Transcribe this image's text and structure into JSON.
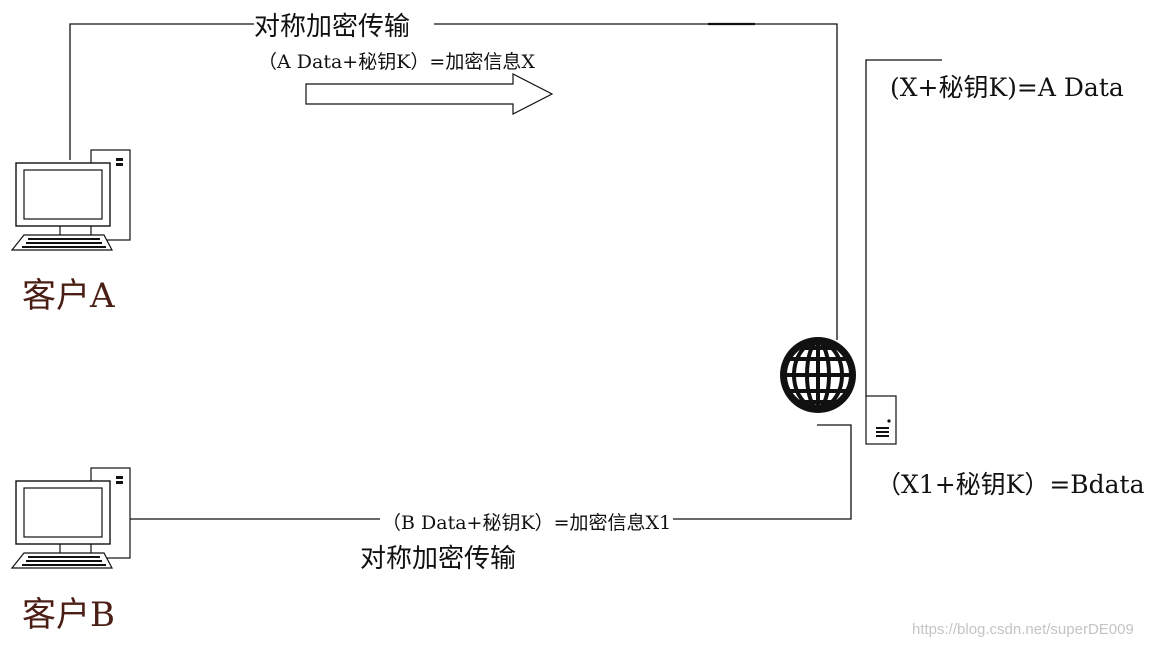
{
  "top_channel": {
    "title": "对称加密传输",
    "formula": "（A Data+秘钥K）=加密信息X"
  },
  "bottom_channel": {
    "title": "对称加密传输",
    "formula": "（B Data+秘钥K）=加密信息X1"
  },
  "client_a": {
    "label": "客户A",
    "icon": "desktop-computer-icon"
  },
  "client_b": {
    "label": "客户B",
    "icon": "desktop-computer-icon"
  },
  "server": {
    "decrypt_a": "(X+秘钥K)=A Data",
    "decrypt_b": "（X1+秘钥K）=Bdata",
    "globe_icon": "globe-icon",
    "server_icon": "server-icon"
  },
  "watermark": "https://blog.csdn.net/superDE009",
  "colors": {
    "line": "#111111",
    "client_label": "#4a1e14",
    "watermark": "#c4c4c4"
  }
}
